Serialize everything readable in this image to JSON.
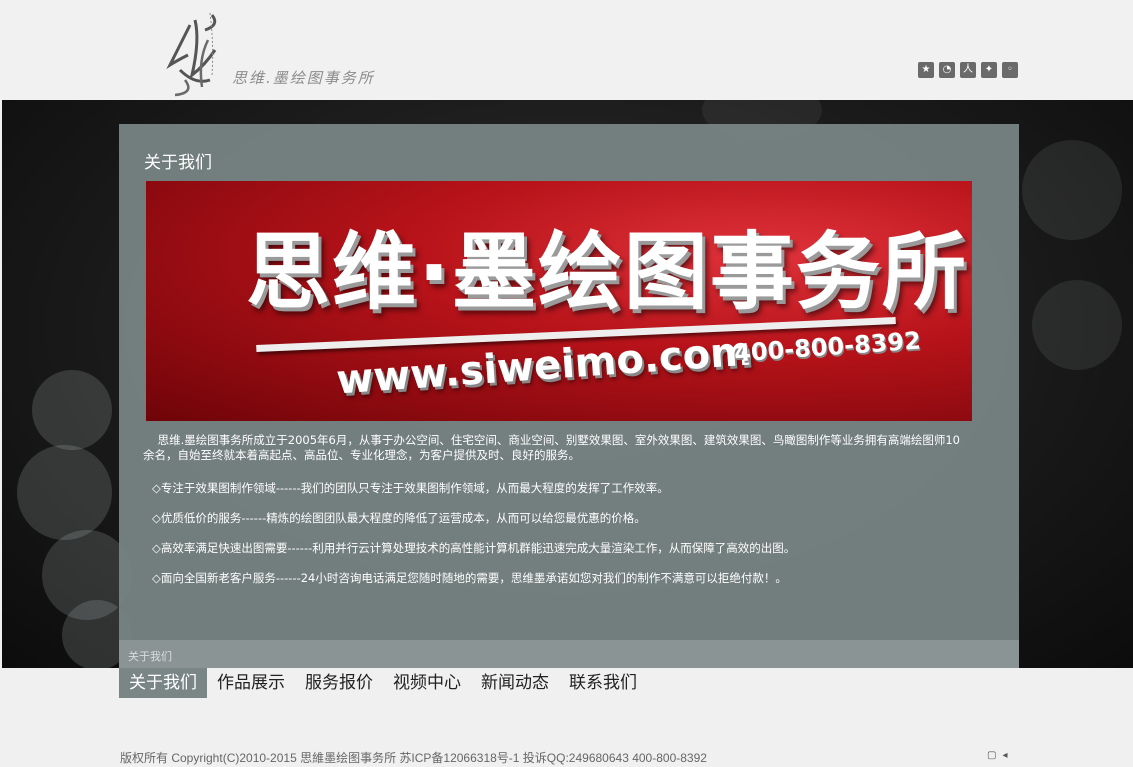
{
  "header": {
    "logo_text": "思维.墨绘图事务所",
    "social_icons": [
      "star-icon",
      "rss-icon",
      "people-icon",
      "star-badge-icon",
      "chat-icon"
    ]
  },
  "panel": {
    "title": "关于我们",
    "banner": {
      "headline": "思维·墨绘图事务所",
      "url": "www.siweimo.com",
      "phone": "400-800-8392"
    },
    "intro": "思维.墨绘图事务所成立于2005年6月，从事于办公空间、住宅空间、商业空间、别墅效果图、室外效果图、建筑效果图、鸟瞰图制作等业务拥有高端绘图师10余名，自始至终就本着高起点、高品位、专业化理念，为客户提供及时、良好的服务。",
    "points": [
      "◇专注于效果图制作领域------我们的团队只专注于效果图制作领域，从而最大程度的发挥了工作效率。",
      "◇优质低价的服务------精炼的绘图团队最大程度的降低了运营成本，从而可以给您最优惠的价格。",
      "◇高效率满足快速出图需要------利用并行云计算处理技术的高性能计算机群能迅速完成大量渲染工作，从而保障了高效的出图。",
      "◇面向全国新老客户服务------24小时咨询电话满足您随时随地的需要，思维墨承诺如您对我们的制作不满意可以拒绝付款！。"
    ],
    "footer_label": "关于我们"
  },
  "nav": {
    "items": [
      {
        "label": "关于我们",
        "active": true
      },
      {
        "label": "作品展示"
      },
      {
        "label": "服务报价"
      },
      {
        "label": "视频中心"
      },
      {
        "label": "新闻动态"
      },
      {
        "label": "联系我们"
      }
    ]
  },
  "footer": {
    "copyright": "版权所有 Copyright(C)2010-2015 思維墨绘图事务所  苏ICP备12066318号-1 投诉QQ:249680643   400-800-8392",
    "icons": [
      "window-icon",
      "speaker-icon"
    ]
  },
  "colors": {
    "panel_bg": "#7a8585",
    "nav_active_bg": "#7a8585",
    "banner_red": "#b8131a"
  }
}
